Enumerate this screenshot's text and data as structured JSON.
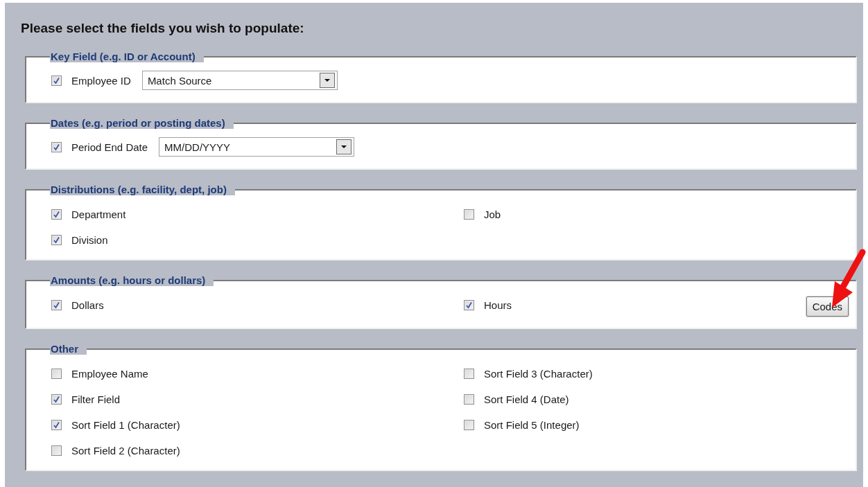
{
  "heading": "Please select the fields you wish to populate:",
  "groups": [
    {
      "legend": "Key Field (e.g. ID or Account)",
      "kind": "inline",
      "fields": [
        {
          "label": "Employee ID",
          "checked": true,
          "dropdown": {
            "value": "Match Source"
          }
        }
      ]
    },
    {
      "legend": "Dates (e.g. period or posting dates)",
      "kind": "inline",
      "fields": [
        {
          "label": "Period End Date",
          "checked": true,
          "dropdown": {
            "value": "MM/DD/YYYY"
          }
        }
      ]
    },
    {
      "legend": "Distributions (e.g. facility, dept, job)",
      "kind": "columns",
      "columns": [
        [
          {
            "label": "Department",
            "checked": true
          },
          {
            "label": "Division",
            "checked": true
          }
        ],
        [
          {
            "label": "Job",
            "checked": false
          }
        ]
      ]
    },
    {
      "legend": "Amounts (e.g. hours or dollars)",
      "kind": "columns",
      "columns": [
        [
          {
            "label": "Dollars",
            "checked": true
          }
        ],
        [
          {
            "label": "Hours",
            "checked": true
          }
        ]
      ],
      "button": "Codes"
    },
    {
      "legend": "Other",
      "kind": "columns",
      "columns": [
        [
          {
            "label": "Employee Name",
            "checked": false
          },
          {
            "label": "Filter Field",
            "checked": true
          },
          {
            "label": "Sort Field 1 (Character)",
            "checked": true
          },
          {
            "label": "Sort Field 2 (Character)",
            "checked": false
          }
        ],
        [
          {
            "label": "Sort Field 3 (Character)",
            "checked": false
          },
          {
            "label": "Sort Field 4 (Date)",
            "checked": false
          },
          {
            "label": "Sort Field 5 (Integer)",
            "checked": false
          }
        ]
      ]
    }
  ]
}
